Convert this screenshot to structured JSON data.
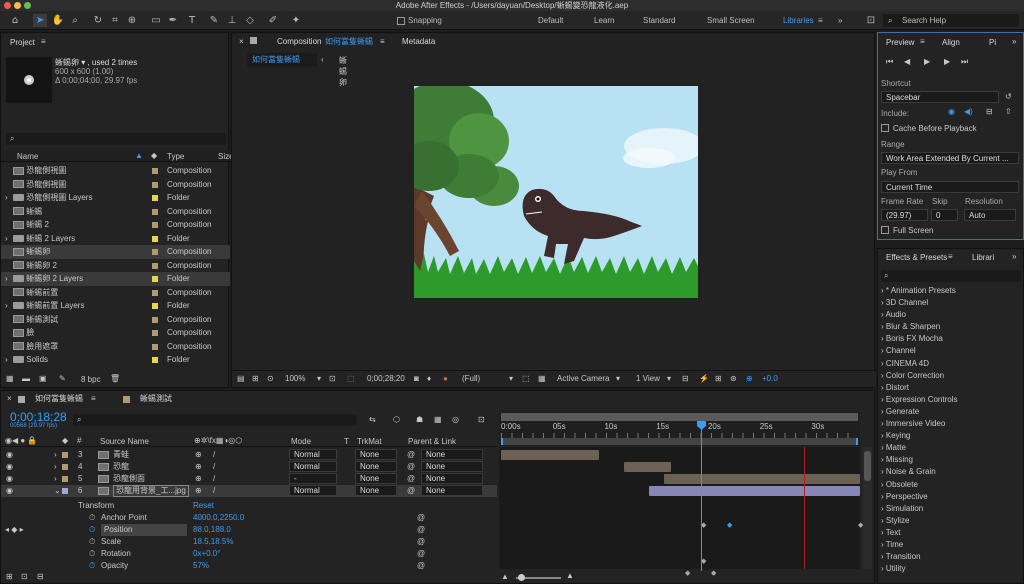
{
  "titlebar": {
    "title": "Adobe After Effects - /Users/dayuan/Desktop/蜥蜴變恐龍液化.aep"
  },
  "toolbar": {
    "snapping": "Snapping",
    "workspaces": [
      "Default",
      "Learn",
      "Standard",
      "Small Screen",
      "Libraries"
    ],
    "active_workspace": "Libraries",
    "search": "Search Help"
  },
  "project": {
    "tab": "Project",
    "item_name": "蜥蜴卵 ▾ , used 2 times",
    "item_size": "600 x 600 (1.00)",
    "item_duration": "Δ 0;00;04;00, 29.97 fps",
    "col_name": "Name",
    "col_type": "Type",
    "col_size": "Size",
    "bpc": "8 bpc",
    "items": [
      {
        "name": "恐龍側視圖",
        "type": "Composition",
        "kind": "comp",
        "color": "#b09a70",
        "selected": false,
        "arrow": false
      },
      {
        "name": "恐龍側視圖",
        "type": "Composition",
        "kind": "comp",
        "color": "#b09a70",
        "selected": false,
        "arrow": false
      },
      {
        "name": "恐龍側視圖 Layers",
        "type": "Folder",
        "kind": "folder",
        "color": "#e8d54a",
        "selected": false,
        "arrow": true
      },
      {
        "name": "蜥蜴",
        "type": "Composition",
        "kind": "comp",
        "color": "#b09a70",
        "selected": false,
        "arrow": false
      },
      {
        "name": "蜥蜴 2",
        "type": "Composition",
        "kind": "comp",
        "color": "#b09a70",
        "selected": false,
        "arrow": false
      },
      {
        "name": "蜥蜴 2 Layers",
        "type": "Folder",
        "kind": "folder",
        "color": "#e8d54a",
        "selected": false,
        "arrow": true
      },
      {
        "name": "蜥蜴卵",
        "type": "Composition",
        "kind": "comp",
        "color": "#b09a70",
        "selected": true,
        "arrow": false
      },
      {
        "name": "蜥蜴卵 2",
        "type": "Composition",
        "kind": "comp",
        "color": "#b09a70",
        "selected": false,
        "arrow": false
      },
      {
        "name": "蜥蜴卵 2 Layers",
        "type": "Folder",
        "kind": "folder",
        "color": "#e8d54a",
        "selected": true,
        "arrow": true
      },
      {
        "name": "蜥蜴前置",
        "type": "Composition",
        "kind": "comp",
        "color": "#b09a70",
        "selected": false,
        "arrow": false
      },
      {
        "name": "蜥蜴前置 Layers",
        "type": "Folder",
        "kind": "folder",
        "color": "#e8d54a",
        "selected": false,
        "arrow": true
      },
      {
        "name": "蜥蜴測試",
        "type": "Composition",
        "kind": "comp",
        "color": "#b09a70",
        "selected": false,
        "arrow": false
      },
      {
        "name": "臉",
        "type": "Composition",
        "kind": "comp",
        "color": "#b09a70",
        "selected": false,
        "arrow": false
      },
      {
        "name": "臉用遮罩",
        "type": "Composition",
        "kind": "comp",
        "color": "#b09a70",
        "selected": false,
        "arrow": false
      },
      {
        "name": "Solids",
        "type": "Folder",
        "kind": "folder",
        "color": "#e8d54a",
        "selected": false,
        "arrow": true
      }
    ]
  },
  "viewer": {
    "tab_prefix": "Composition",
    "tab_comp": "如何當隻蜥蜴",
    "tab_meta": "Metadata",
    "crumb1": "如何當隻蜥蜴",
    "crumb2": "蜥蜴卵",
    "zoom": "100%",
    "timecode": "0;00;28;20",
    "resolution": "(Full)",
    "camera": "Active Camera",
    "views": "1 View",
    "exposure": "+0.0"
  },
  "preview": {
    "tab": "Preview",
    "tab2": "Align",
    "tab3": "Pi",
    "shortcut_label": "Shortcut",
    "shortcut": "Spacebar",
    "include_label": "Include:",
    "cache_label": "Cache Before Playback",
    "range_label": "Range",
    "range": "Work Area Extended By Current ...",
    "playfrom_label": "Play From",
    "playfrom": "Current Time",
    "fr_label": "Frame Rate",
    "skip_label": "Skip",
    "res_label": "Resolution",
    "fr": "(29.97)",
    "skip": "0",
    "res": "Auto",
    "fullscreen": "Full Screen"
  },
  "effects": {
    "tab": "Effects & Presets",
    "tab2": "Librari",
    "items": [
      "* Animation Presets",
      "3D Channel",
      "Audio",
      "Blur & Sharpen",
      "Boris FX Mocha",
      "Channel",
      "CINEMA 4D",
      "Color Correction",
      "Distort",
      "Expression Controls",
      "Generate",
      "Immersive Video",
      "Keying",
      "Matte",
      "Missing",
      "Noise & Grain",
      "Obsolete",
      "Perspective",
      "Simulation",
      "Stylize",
      "Text",
      "Time",
      "Transition",
      "Utility"
    ]
  },
  "timeline": {
    "tab": "如何當隻蜥蜴",
    "tab2": "蜥蜴測試",
    "timecode": "0;00;18;28",
    "frame": "00568 (29.97 fps)",
    "col_source": "Source Name",
    "col_mode": "Mode",
    "col_t": "T",
    "col_trkmat": "TrkMat",
    "col_parent": "Parent & Link",
    "ruler": [
      "0:00s",
      "05s",
      "10s",
      "15s",
      "20s",
      "25s",
      "30s"
    ],
    "layers": [
      {
        "num": "3",
        "name": "青蛙",
        "color": "#b09a70",
        "mode": "Normal",
        "trk": "None",
        "parent": "None"
      },
      {
        "num": "4",
        "name": "恐龍",
        "color": "#b09a70",
        "mode": "Normal",
        "trk": "None",
        "parent": "None"
      },
      {
        "num": "5",
        "name": "恐龍側面",
        "color": "#b09a70",
        "mode": "-",
        "trk": "None",
        "parent": "None"
      },
      {
        "num": "6",
        "name": "恐龍用背景_工...jpg",
        "color": "#a6a6d6",
        "mode": "Normal",
        "trk": "None",
        "parent": "None"
      }
    ],
    "transform": "Transform",
    "reset": "Reset",
    "props": [
      {
        "name": "Anchor Point",
        "value": "4000.0,2250.0"
      },
      {
        "name": "Position",
        "value": "88.0,188.0"
      },
      {
        "name": "Scale",
        "value": "18.5,18.5%"
      },
      {
        "name": "Rotation",
        "value": "0x+0.0°"
      },
      {
        "name": "Opacity",
        "value": "57%"
      }
    ]
  },
  "colors": {
    "accent": "#3d9cf0",
    "label_tan": "#b09a70",
    "label_yellow": "#e8d54a",
    "label_lavender": "#a6a6d6",
    "sky": "#b8e1f4",
    "ground": "#2f9a2c",
    "dino": "#3d2a2a"
  }
}
